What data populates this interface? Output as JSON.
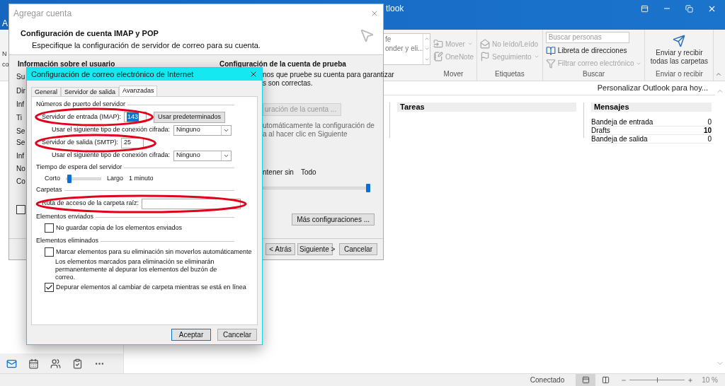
{
  "outlook": {
    "title": "tlook",
    "edge_fragments": [
      "A",
      "N",
      "co"
    ],
    "gallery": [
      "fe",
      "onder y eli..."
    ],
    "ribbon_groups": [
      {
        "kind": "buttons",
        "label": "Mover",
        "items": [
          {
            "kind": "move",
            "text": "Mover",
            "dropdown": true,
            "disabled": true
          },
          {
            "kind": "onenote",
            "text": "OneNote",
            "dropdown": false,
            "disabled": true
          }
        ]
      },
      {
        "kind": "buttons",
        "label": "Etiquetas",
        "items": [
          {
            "kind": "read",
            "text": "No leído/Leído",
            "dropdown": false,
            "disabled": true
          },
          {
            "kind": "flag",
            "text": "Seguimiento",
            "dropdown": true,
            "disabled": true
          }
        ]
      },
      {
        "kind": "search",
        "label": "Buscar",
        "placeholder": "Buscar personas",
        "items": [
          {
            "kind": "book",
            "text": "Libreta de direcciones",
            "dropdown": false,
            "disabled": false
          },
          {
            "kind": "filter",
            "text": "Filtrar correo electrónico",
            "dropdown": true,
            "disabled": true
          }
        ]
      },
      {
        "kind": "big",
        "label": "Enviar o recibir",
        "text": "Enviar y recibir todas las carpetas"
      }
    ],
    "customize_link": "Personalizar Outlook para hoy...",
    "tasks_title": "Tareas",
    "messages": {
      "title": "Mensajes",
      "rows": [
        {
          "label": "Bandeja de entrada",
          "count": "0",
          "bold": false
        },
        {
          "label": "Drafts",
          "count": "10",
          "bold": true
        },
        {
          "label": "Bandeja de salida",
          "count": "0",
          "bold": false
        }
      ]
    },
    "nav": [
      {
        "kind": "mail",
        "selected": true
      },
      {
        "kind": "calendar",
        "selected": false
      },
      {
        "kind": "people",
        "selected": false
      },
      {
        "kind": "tasks",
        "selected": false
      },
      {
        "kind": "more",
        "selected": false
      }
    ],
    "status": {
      "text": "Conectado",
      "views": [
        {
          "kind": "normal",
          "selected": true
        },
        {
          "kind": "reading",
          "selected": false
        }
      ],
      "zoom_slider": {
        "level": 0.5
      },
      "zoom": "10 %"
    }
  },
  "add_account": {
    "title": "Agregar cuenta",
    "heading": "Configuración de cuenta IMAP y POP",
    "subheading": "Especifique la configuración de servidor de correo para su cuenta.",
    "user_info_heading": "Información sobre el usuario",
    "left_fragments": [
      "Su",
      "Dir",
      "Inf",
      "Ti",
      "Se",
      "Se",
      "Inf",
      "No",
      "Co"
    ],
    "remember_checkbox": {
      "checked": false
    },
    "test_heading": "Configuración de la cuenta de prueba",
    "test_text": [
      "nos que pruebe su cuenta para garantizar",
      "s son correctas."
    ],
    "test_button": "uración de la cuenta ...",
    "auto_text": [
      "utomáticamente la configuración de",
      "a al hacer clic en Siguiente"
    ],
    "keep_label": "ntener sin",
    "keep_value": "Todo",
    "keep_slider": {
      "level": 1
    },
    "more_button": "Más configuraciones ...",
    "buttons": [
      "< Atrás",
      "Siguiente >",
      "Cancelar"
    ]
  },
  "internet": {
    "title": "Configuración de correo electrónico de Internet",
    "tabs": [
      {
        "label": "General",
        "selected": false
      },
      {
        "label": "Servidor de salida",
        "selected": false
      },
      {
        "label": "Avanzadas",
        "selected": true
      }
    ],
    "ports": {
      "heading": "Números de puerto del servidor",
      "incoming": {
        "label": "Servidor de entrada (IMAP):",
        "value": "143",
        "text_selected": true
      },
      "default_button": "Usar predeterminados",
      "incoming_encryption": {
        "label": "Usar el siguiente tipo de conexión cifrada:",
        "value": "Ninguno"
      },
      "outgoing": {
        "label": "Servidor de salida (SMTP):",
        "value": "25",
        "text_selected": false
      },
      "outgoing_encryption": {
        "label": "Usar el siguiente tipo de conexión cifrada:",
        "value": "Ninguno"
      }
    },
    "timeout": {
      "heading": "Tiempo de espera del servidor",
      "min": "Corto",
      "max": "Largo",
      "level": 0.08,
      "value": "1 minuto"
    },
    "folders": {
      "heading": "Carpetas",
      "root_label": "Ruta de acceso de la carpeta raíz:"
    },
    "sent": {
      "heading": "Elementos enviados",
      "options": [
        {
          "kind": "checkbox",
          "label": "No guardar copia de los elementos enviados",
          "checked": false
        }
      ]
    },
    "deleted": {
      "heading": "Elementos eliminados",
      "options": [
        {
          "kind": "checkbox",
          "label": "Marcar elementos para su eliminación sin moverlos automáticamente",
          "checked": false
        },
        {
          "kind": "note",
          "label": "Los elementos marcados para eliminación se eliminarán permanentemente al depurar los elementos del buzón de correo."
        },
        {
          "kind": "checkbox",
          "label": "Depurar elementos al cambiar de carpeta mientras se está en línea",
          "checked": true
        }
      ]
    },
    "buttons": [
      {
        "label": "Aceptar",
        "default": true
      },
      {
        "label": "Cancelar",
        "default": false
      }
    ]
  }
}
